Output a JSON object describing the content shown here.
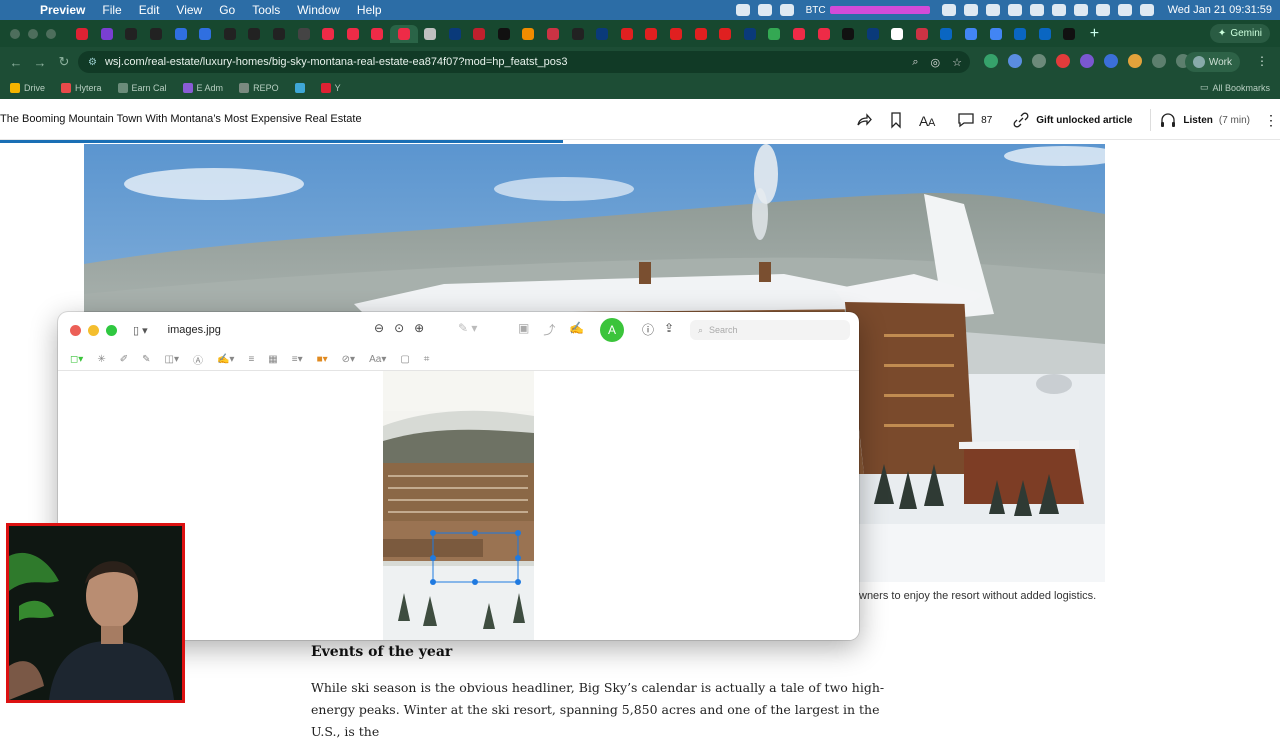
{
  "menubar": {
    "app_name": "Preview",
    "items": [
      "File",
      "Edit",
      "View",
      "Go",
      "Tools",
      "Window",
      "Help"
    ],
    "btc_label": "BTC",
    "clock": "Wed Jan 21  09:31:59"
  },
  "browser": {
    "url": "wsj.com/real-estate/luxury-homes/big-sky-montana-real-estate-ea874f07?mod=hp_featst_pos3",
    "profile_label": "Work",
    "gemini_label": "Gemini",
    "new_tab_label": "+",
    "bookmarks": [
      "Drive",
      "Hytera",
      "Earn Cal",
      "E Adm",
      "REPO",
      "Y"
    ],
    "all_bookmarks_label": "All Bookmarks"
  },
  "article": {
    "header_title": "The Booming Mountain Town With Montana’s Most Expensive Real Estate",
    "comment_count": "87",
    "gift_label": "Gift unlocked article",
    "listen_label": "Listen",
    "listen_duration": "(7 min)",
    "caption_fragment": "wners to enjoy the resort without added logistics.",
    "section_heading": "Events of the year",
    "paragraph": "While ski season is the obvious headliner, Big Sky’s calendar is actually a tale of two high-energy peaks. Winter at the ski resort, spanning 5,850 acres and one of the largest in the U.S., is the",
    "read_progress": 0.44
  },
  "preview": {
    "filename": "images.jpg",
    "search_placeholder": "Search",
    "font_tool": "Aa"
  }
}
